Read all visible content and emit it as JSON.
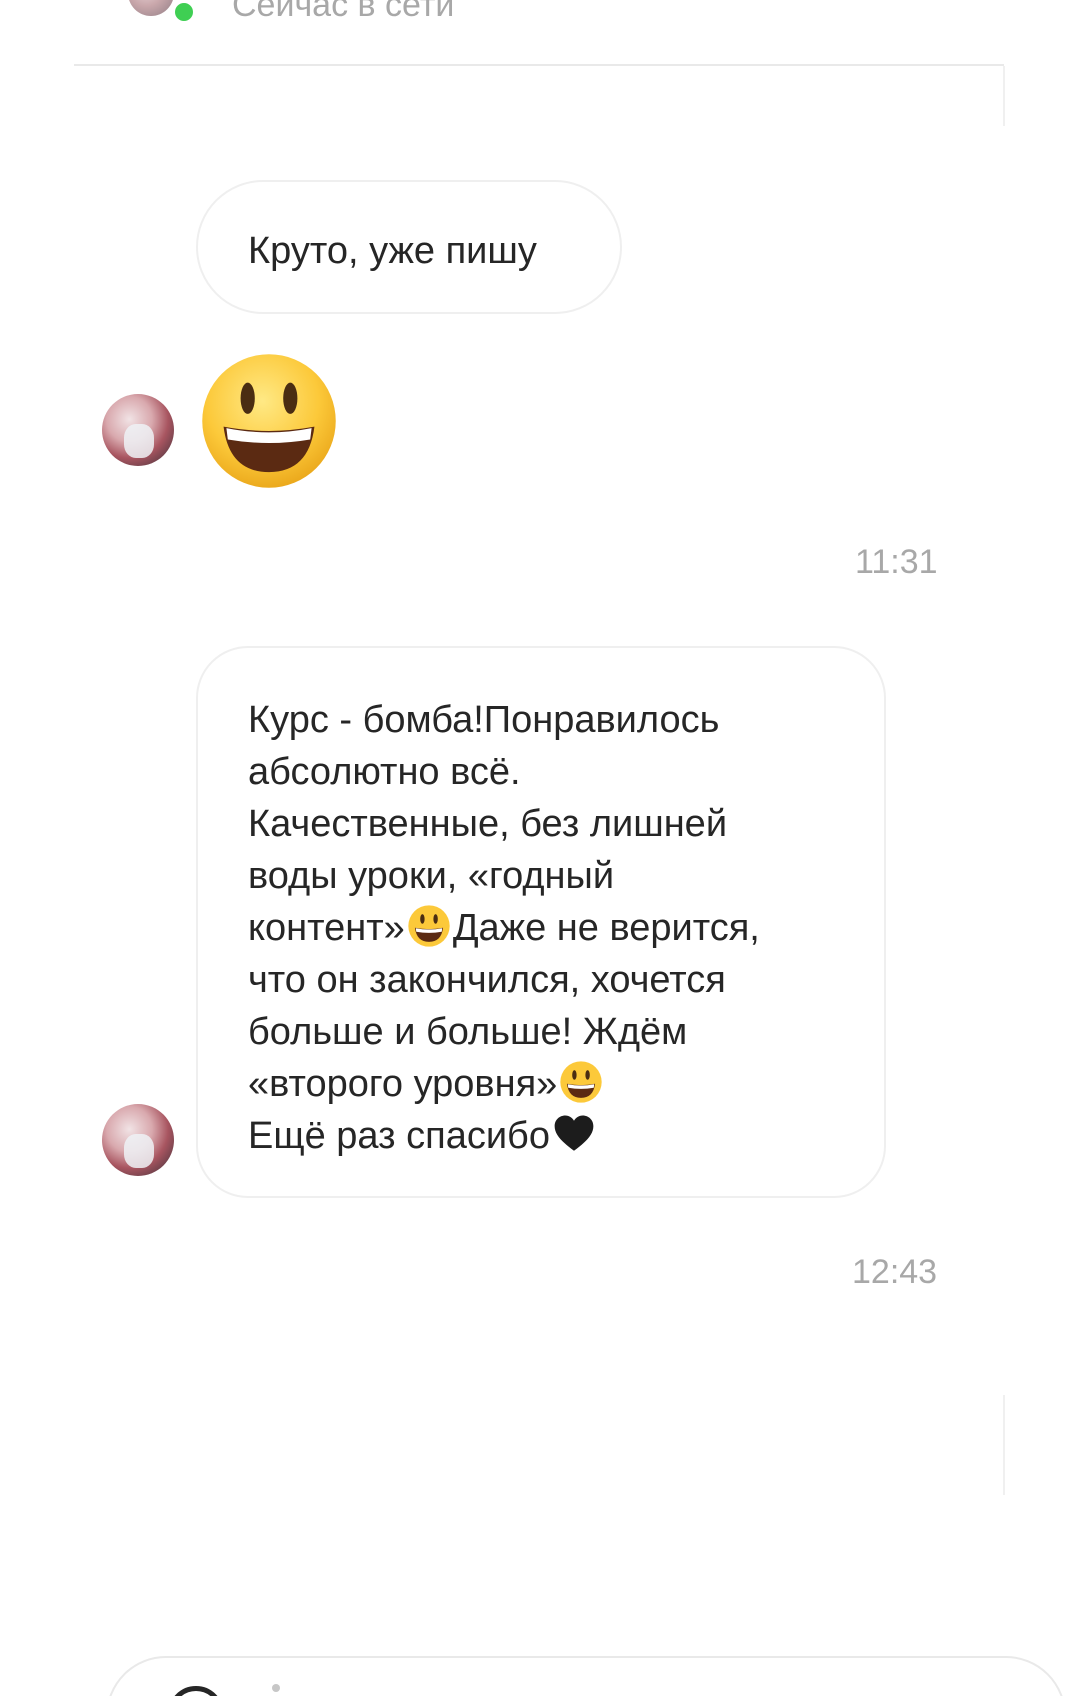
{
  "header": {
    "status": "Сейчас в сети"
  },
  "messages": [
    {
      "text": "Круто, уже пишу"
    },
    {
      "emoji": "grinning-face-emoji"
    },
    {
      "lines": [
        "Курс - бомба!Понравилось",
        "абсолютно всё.",
        "Качественные, без лишней",
        "воды уроки, «годный",
        "контент»",
        "Даже не верится,",
        "что он закончился, хочется",
        "больше и больше! Ждём",
        "«второго уровня»",
        "Ещё раз спасибо"
      ]
    }
  ],
  "timestamps": [
    "11:31",
    "12:43"
  ],
  "colors": {
    "online": "#3fcf53",
    "bubble_border": "#efefef",
    "meta_text": "#a8a8a8",
    "text": "#262626"
  }
}
